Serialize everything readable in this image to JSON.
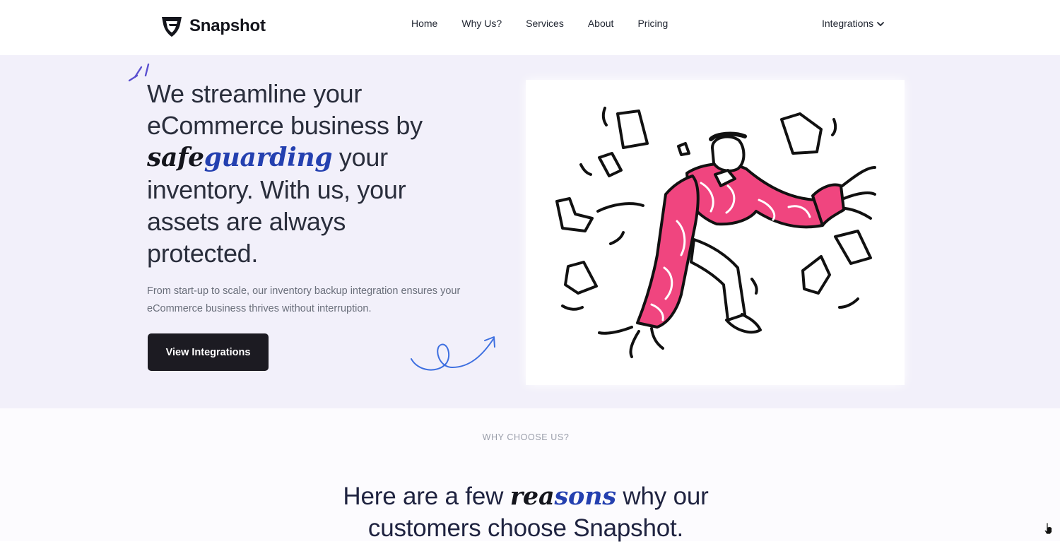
{
  "nav": {
    "brand": "Snapshot",
    "links": [
      "Home",
      "Why Us?",
      "Services",
      "About",
      "Pricing"
    ],
    "dropdown_label": "Integrations"
  },
  "hero": {
    "title_line1": "We streamline your",
    "title_line2": "eCommerce business by",
    "title_accent_a": "safe",
    "title_accent_b": "guarding",
    "title_after_accent": " your",
    "title_line4": "inventory. With us, your",
    "title_line5": "assets are always",
    "title_line6": "protected.",
    "subtitle": "From start-up to scale, our inventory backup integration ensures your eCommerce business thrives without interruption.",
    "cta_label": "View Integrations"
  },
  "why": {
    "eyebrow": "WHY CHOOSE US?",
    "title_before": "Here are a few ",
    "title_accent_a": "rea",
    "title_accent_b": "sons",
    "title_after": " why our",
    "title_line2": "customers choose Snapshot."
  },
  "colors": {
    "hero_bg": "#f2f0fa",
    "accent_blue": "#2440b0",
    "illustration_pink": "#f0457f",
    "cta_bg": "#1c1b22",
    "squiggle_blue": "#3d6fe0"
  },
  "icons": {
    "brand_logo": "shield-logo-icon",
    "dropdown": "chevron-down-icon",
    "cursor": "hand-pointer-icon"
  }
}
